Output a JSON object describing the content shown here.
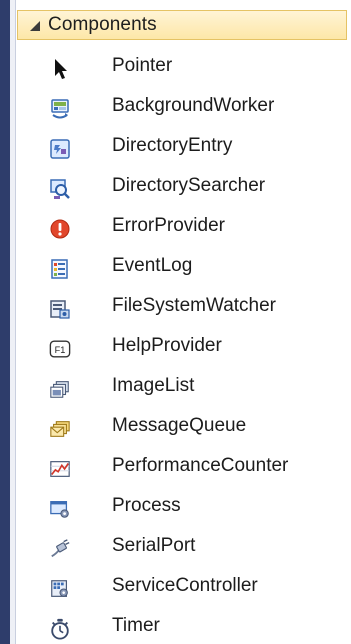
{
  "section": {
    "title": "Components"
  },
  "items": [
    {
      "label": "Pointer",
      "icon": "pointer-arrow-icon"
    },
    {
      "label": "BackgroundWorker",
      "icon": "background-worker-icon"
    },
    {
      "label": "DirectoryEntry",
      "icon": "directory-entry-icon"
    },
    {
      "label": "DirectorySearcher",
      "icon": "directory-searcher-icon"
    },
    {
      "label": "ErrorProvider",
      "icon": "error-provider-icon"
    },
    {
      "label": "EventLog",
      "icon": "event-log-icon"
    },
    {
      "label": "FileSystemWatcher",
      "icon": "file-system-watcher-icon"
    },
    {
      "label": "HelpProvider",
      "icon": "help-provider-icon"
    },
    {
      "label": "ImageList",
      "icon": "image-list-icon"
    },
    {
      "label": "MessageQueue",
      "icon": "message-queue-icon"
    },
    {
      "label": "PerformanceCounter",
      "icon": "performance-counter-icon"
    },
    {
      "label": "Process",
      "icon": "process-icon"
    },
    {
      "label": "SerialPort",
      "icon": "serial-port-icon"
    },
    {
      "label": "ServiceController",
      "icon": "service-controller-icon"
    },
    {
      "label": "Timer",
      "icon": "timer-icon"
    }
  ],
  "help_provider_glyph": "F1",
  "colors": {
    "header_fill": "#fde7a8",
    "header_border": "#e5c365",
    "left_edge": "#2e3d6b",
    "error_red": "#e1472c"
  }
}
